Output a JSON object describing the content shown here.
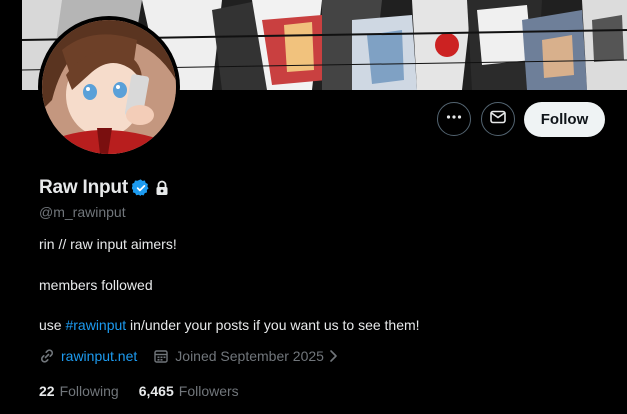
{
  "profile": {
    "display_name": "Raw Input",
    "handle": "@m_rawinput",
    "follow_label": "Follow",
    "bio": {
      "line1": "rin // raw input aimers!",
      "line2": "members followed",
      "line3_prefix": "use ",
      "line3_hashtag": "#rawinput",
      "line3_suffix": " in/under your posts if you want us to see them!"
    },
    "website": "rawinput.net",
    "joined": "Joined September 2025",
    "following_count": "22",
    "following_label": "Following",
    "followers_count": "6,465",
    "followers_label": "Followers"
  },
  "icons": {
    "more": "more-icon",
    "message": "mail-icon",
    "verified": "verified-badge-icon",
    "protected": "lock-icon",
    "link": "link-icon",
    "calendar": "calendar-icon",
    "chevron": "chevron-right-icon"
  },
  "colors": {
    "background": "#000000",
    "accent": "#1d9bf0",
    "text_primary": "#e7e9ea",
    "text_secondary": "#71767b",
    "follow_button_bg": "#eff3f4"
  }
}
